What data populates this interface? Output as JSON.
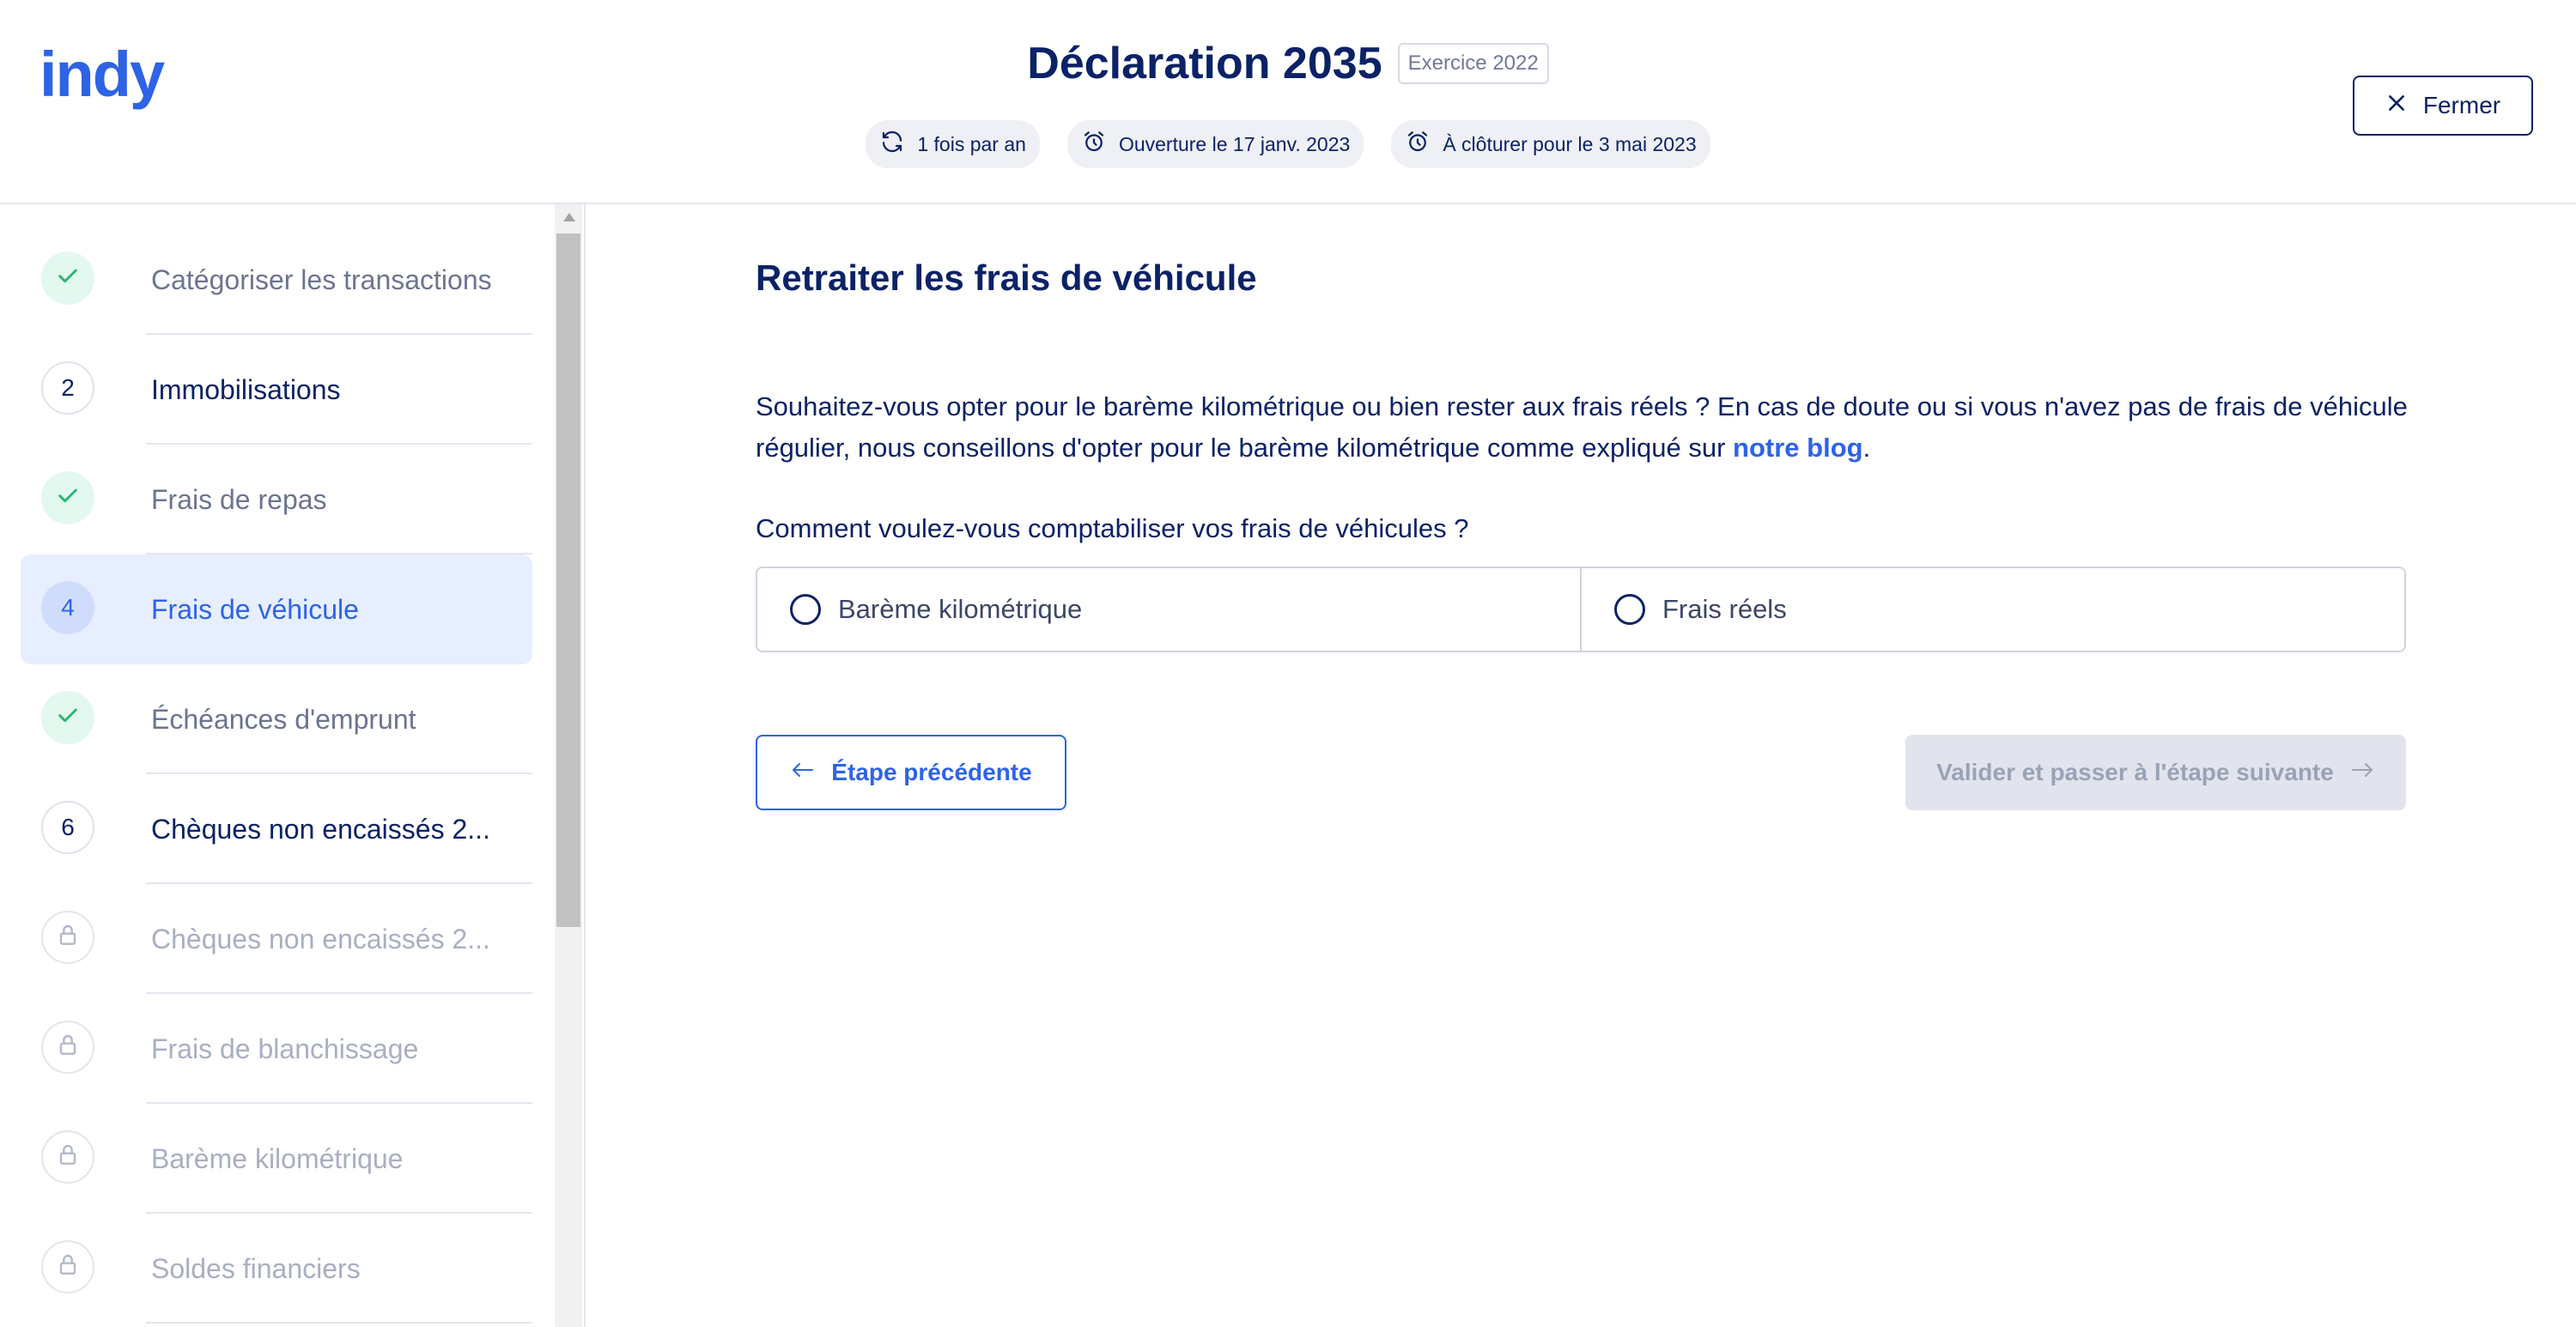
{
  "header": {
    "logo": "indy",
    "title": "Déclaration 2035",
    "badge": "Exercice 2022",
    "chips": [
      {
        "icon": "refresh-icon",
        "label": "1 fois par an"
      },
      {
        "icon": "alarm-clock-icon",
        "label": "Ouverture le 17 janv. 2023"
      },
      {
        "icon": "alarm-clock-icon",
        "label": "À clôturer pour le 3 mai 2023"
      }
    ],
    "close_label": "Fermer"
  },
  "sidebar": {
    "steps": [
      {
        "marker": "",
        "status": "done",
        "label": "Catégoriser les transactions"
      },
      {
        "marker": "2",
        "status": "todo",
        "label": "Immobilisations"
      },
      {
        "marker": "",
        "status": "done",
        "label": "Frais de repas"
      },
      {
        "marker": "4",
        "status": "active",
        "label": "Frais de véhicule"
      },
      {
        "marker": "",
        "status": "done",
        "label": "Échéances d'emprunt"
      },
      {
        "marker": "6",
        "status": "todo",
        "label": "Chèques non encaissés 2..."
      },
      {
        "marker": "",
        "status": "locked",
        "label": "Chèques non encaissés 2..."
      },
      {
        "marker": "",
        "status": "locked",
        "label": "Frais de blanchissage"
      },
      {
        "marker": "",
        "status": "locked",
        "label": "Barème kilométrique"
      },
      {
        "marker": "",
        "status": "locked",
        "label": "Soldes financiers"
      }
    ]
  },
  "main": {
    "title": "Retraiter les frais de véhicule",
    "description": "Souhaitez-vous opter pour le barème kilométrique ou bien rester aux frais réels ? En cas de doute ou si vous n'avez pas de frais de véhicule régulier, nous conseillons d'opter pour le barème kilométrique comme expliqué sur",
    "link": "notre blog",
    "description_end": ".",
    "question": "Comment voulez-vous comptabiliser vos frais de véhicules ?",
    "options": [
      "Barème kilométrique",
      "Frais réels"
    ],
    "prev_label": "Étape précédente",
    "next_label": "Valider et passer à l'étape suivante"
  },
  "colors": {
    "brand": "#2d63e6",
    "navy": "#0b2266",
    "active_bg": "#e6eeff",
    "done_bg": "#e3f8ef",
    "check": "#2bb673",
    "disabled_bg": "#e1e4ec"
  }
}
